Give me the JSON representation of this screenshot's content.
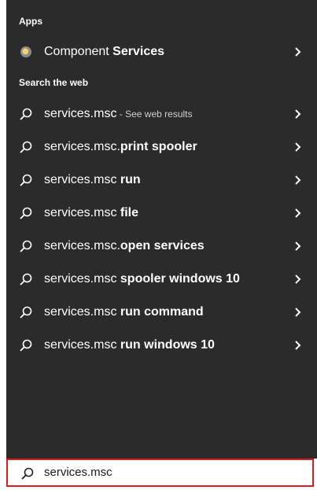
{
  "apps_header": "Apps",
  "app_result": {
    "prefix": "Component ",
    "bold": "Services",
    "icon": "component-services-icon"
  },
  "web_header": "Search the web",
  "web_results": [
    {
      "prefix": "services.msc",
      "bold": "",
      "hint": " - See web results"
    },
    {
      "prefix": "services.msc.",
      "bold": "print spooler",
      "hint": ""
    },
    {
      "prefix": "services.msc ",
      "bold": "run",
      "hint": ""
    },
    {
      "prefix": "services.msc ",
      "bold": "file",
      "hint": ""
    },
    {
      "prefix": "services.msc.",
      "bold": "open services",
      "hint": ""
    },
    {
      "prefix": "services.msc ",
      "bold": "spooler windows 10",
      "hint": ""
    },
    {
      "prefix": "services.msc ",
      "bold": "run command",
      "hint": ""
    },
    {
      "prefix": "services.msc ",
      "bold": "run windows 10",
      "hint": ""
    }
  ],
  "search_box": {
    "value": "services.msc"
  },
  "colors": {
    "panel_bg": "#2b2b2b",
    "text": "#ffffff",
    "search_border": "#e21a1a"
  }
}
